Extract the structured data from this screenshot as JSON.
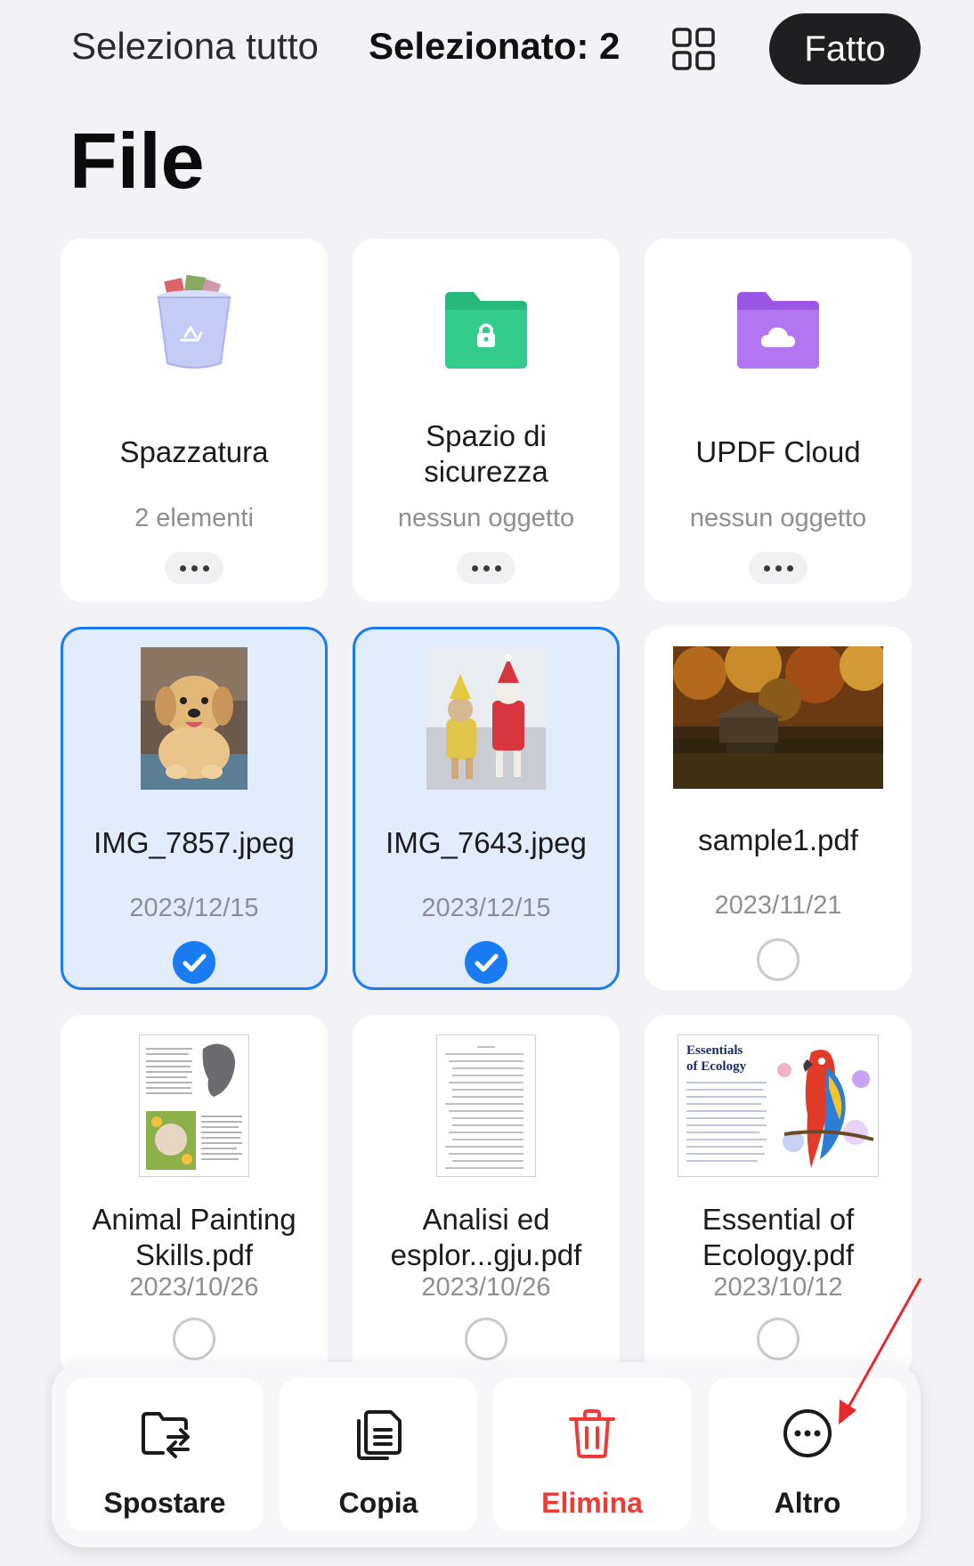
{
  "header": {
    "select_all": "Seleziona tutto",
    "selected_count": "Selezionato: 2",
    "done_label": "Fatto",
    "view_icon": "grid-view-icon"
  },
  "page_title": "File",
  "folders": [
    {
      "name": "Spazzatura",
      "sub": "2 elementi",
      "icon": "trash-bin-icon"
    },
    {
      "name": "Spazio di sicurezza",
      "sub": "nessun oggetto",
      "icon": "lock-folder-icon",
      "color": "#2fc58a"
    },
    {
      "name": "UPDF Cloud",
      "sub": "nessun oggetto",
      "icon": "cloud-folder-icon",
      "color": "#b06cf0"
    }
  ],
  "files": [
    {
      "name": "IMG_7857.jpeg",
      "date": "2023/12/15",
      "selected": true
    },
    {
      "name": "IMG_7643.jpeg",
      "date": "2023/12/15",
      "selected": true
    },
    {
      "name": "sample1.pdf",
      "date": "2023/11/21",
      "selected": false
    },
    {
      "name": "Animal Painting Skills.pdf",
      "date": "2023/10/26",
      "selected": false
    },
    {
      "name": "Analisi ed esplor...gju.pdf",
      "date": "2023/10/26",
      "selected": false
    },
    {
      "name": "Essential of Ecology.pdf",
      "date": "2023/10/12",
      "selected": false
    }
  ],
  "thumb_text": {
    "ecology_title_1": "Essentials",
    "ecology_title_2": "of Ecology"
  },
  "toolbar": {
    "move": "Spostare",
    "copy": "Copia",
    "delete": "Elimina",
    "more": "Altro"
  },
  "colors": {
    "accent": "#1a7cf2",
    "danger": "#ef3b35",
    "done_button": "#1f1f21"
  }
}
